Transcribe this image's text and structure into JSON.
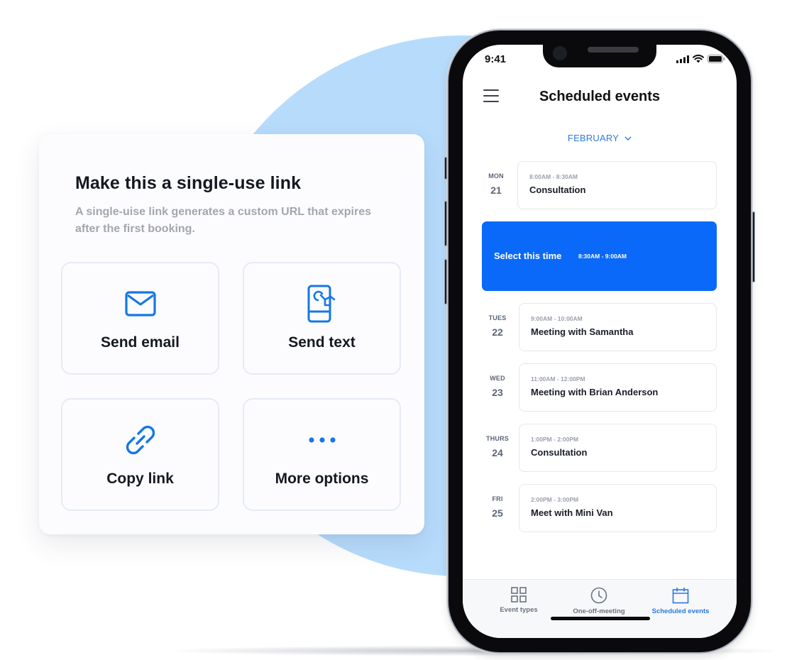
{
  "share_card": {
    "title": "Make this a single-use link",
    "description": "A single-uise link generates a custom URL that expires after the first booking.",
    "options": [
      {
        "label": "Send email",
        "icon": "envelope-icon"
      },
      {
        "label": "Send text",
        "icon": "phone-tap-icon"
      },
      {
        "label": "Copy link",
        "icon": "link-icon"
      },
      {
        "label": "More options",
        "icon": "more-dots-icon"
      }
    ]
  },
  "phone": {
    "status_bar": {
      "time": "9:41",
      "icons": [
        "signal-icon",
        "wifi-icon",
        "battery-icon"
      ]
    },
    "header": {
      "title": "Scheduled events",
      "menu_icon": "hamburger-menu-icon"
    },
    "month_selector": {
      "value": "FEBRUARY",
      "icon": "chevron-down-icon"
    },
    "days": [
      {
        "dow": "MON",
        "day": "21",
        "events": [
          {
            "time": "8:00AM - 8:30AM",
            "title": "Consultation"
          }
        ]
      },
      {
        "dow": "TUES",
        "day": "22",
        "events": [
          {
            "time": "9:00AM - 10:00AM",
            "title": "Meeting with Samantha"
          }
        ]
      },
      {
        "dow": "WED",
        "day": "23",
        "events": [
          {
            "time": "11:00AM - 12:00PM",
            "title": "Meeting with Brian Anderson"
          }
        ]
      },
      {
        "dow": "THURS",
        "day": "24",
        "events": [
          {
            "time": "1:00PM - 2:00PM",
            "title": "Consultation"
          }
        ]
      },
      {
        "dow": "FRI",
        "day": "25",
        "events": [
          {
            "time": "2:00PM - 3:00PM",
            "title": "Meet with Mini Van"
          }
        ]
      }
    ],
    "select_slot": {
      "label": "Select this time",
      "time": "8:30AM - 9:00AM"
    },
    "tab_bar": {
      "tabs": [
        {
          "label": "Event types",
          "icon": "grid-icon",
          "active": false
        },
        {
          "label": "One-off-meeting",
          "icon": "clock-icon",
          "active": false
        },
        {
          "label": "Scheduled events",
          "icon": "calendar-icon",
          "active": true
        }
      ]
    }
  },
  "colors": {
    "accent": "#0a69f8",
    "link_blue": "#2e7ad6",
    "background_circle": "#b7dbfb",
    "muted_text": "#a2a6b0"
  }
}
